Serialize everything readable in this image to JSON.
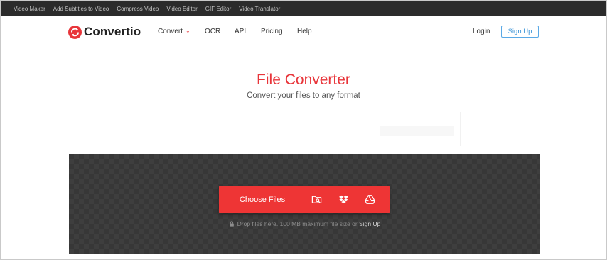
{
  "topbar": {
    "links": [
      "Video Maker",
      "Add Subtitles to Video",
      "Compress Video",
      "Video Editor",
      "GIF Editor",
      "Video Translator"
    ]
  },
  "nav": {
    "brand": "Convertio",
    "items": {
      "convert": "Convert",
      "ocr": "OCR",
      "api": "API",
      "pricing": "Pricing",
      "help": "Help"
    },
    "login": "Login",
    "signup": "Sign Up"
  },
  "hero": {
    "title": "File Converter",
    "subtitle": "Convert your files to any format"
  },
  "upload": {
    "choose_label": "Choose Files",
    "sources": [
      "folder-search-icon",
      "dropbox-icon",
      "google-drive-icon"
    ],
    "hint_text": "Drop files here. 100 MB maximum file size or ",
    "hint_link": "Sign Up"
  },
  "colors": {
    "accent": "#e8353a",
    "topbar_bg": "#2b2b2b",
    "drop_bg": "#373737",
    "signup_border": "#5aa9e6"
  }
}
